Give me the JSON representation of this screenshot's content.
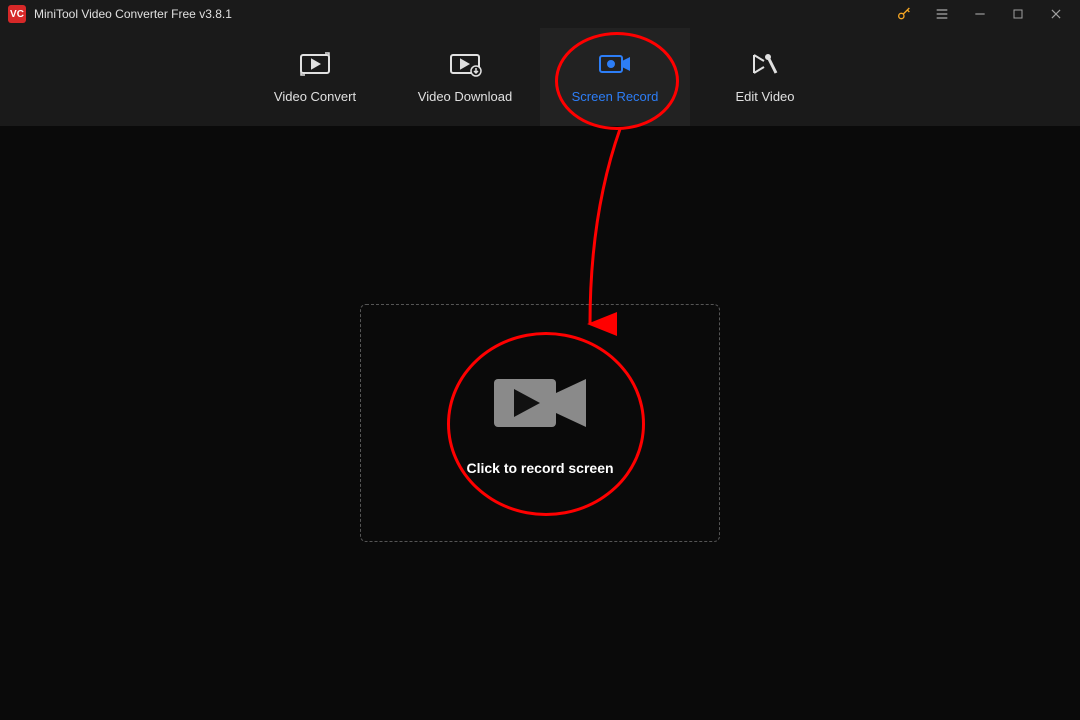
{
  "titlebar": {
    "app_icon_text": "VC",
    "title": "MiniTool Video Converter Free v3.8.1"
  },
  "nav": {
    "items": [
      {
        "label": "Video Convert",
        "icon": "convert-icon",
        "active": false
      },
      {
        "label": "Video Download",
        "icon": "download-icon",
        "active": false
      },
      {
        "label": "Screen Record",
        "icon": "screen-record-icon",
        "active": true
      },
      {
        "label": "Edit Video",
        "icon": "edit-icon",
        "active": false
      }
    ]
  },
  "main": {
    "dropzone_label": "Click to record screen"
  },
  "annotations": {
    "highlight_nav": "Screen Record",
    "highlight_action": "Click to record screen"
  }
}
